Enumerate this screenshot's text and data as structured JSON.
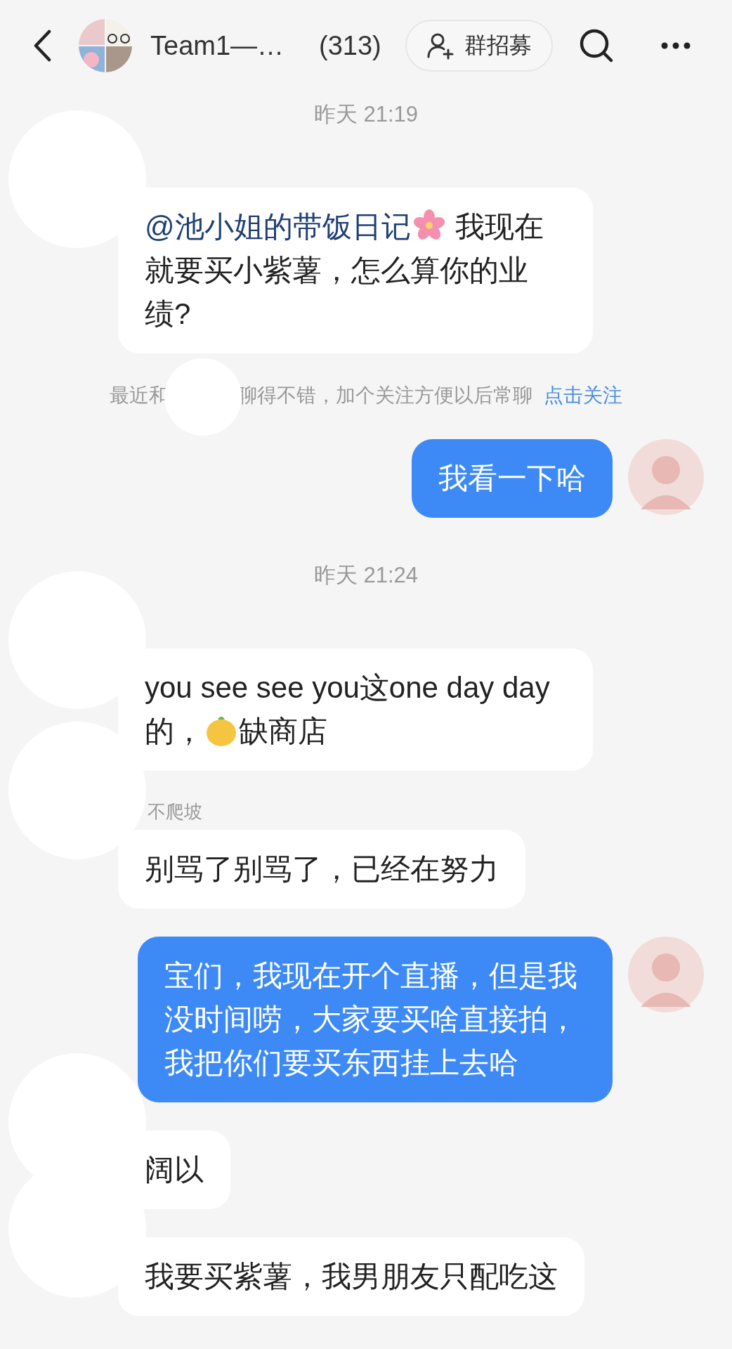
{
  "header": {
    "title": "Team1—…",
    "count": "(313)",
    "recruit_button": "群招募"
  },
  "messages": [
    {
      "kind": "time",
      "text": "昨天 21:19"
    },
    {
      "kind": "incoming",
      "avatar_masked": true,
      "parts": [
        {
          "kind": "mention",
          "text": "@池小姐的带饭日记"
        },
        {
          "kind": "flower"
        },
        {
          "kind": "text",
          "text": " 我现在就要买小紫薯，怎么算你的业绩?"
        }
      ]
    },
    {
      "kind": "notice",
      "before": "最近和",
      "masked": true,
      "after": "聊得不错，加个关注方便以后常聊",
      "link": "点击关注"
    },
    {
      "kind": "outgoing",
      "parts": [
        {
          "kind": "text",
          "text": "我看一下哈"
        }
      ]
    },
    {
      "kind": "time",
      "text": "昨天 21:24"
    },
    {
      "kind": "incoming",
      "avatar_masked": true,
      "parts": [
        {
          "kind": "text",
          "text": "you see see you这one day day 的，"
        },
        {
          "kind": "sticker"
        },
        {
          "kind": "text",
          "text": "缺商店"
        }
      ]
    },
    {
      "kind": "incoming",
      "avatar_masked": true,
      "sender": "不爬坡",
      "parts": [
        {
          "kind": "text",
          "text": "别骂了别骂了，已经在努力"
        }
      ]
    },
    {
      "kind": "outgoing",
      "parts": [
        {
          "kind": "text",
          "text": "宝们，我现在开个直播，但是我没时间唠，大家要买啥直接拍，我把你们要买东西挂上去哈"
        }
      ]
    },
    {
      "kind": "incoming",
      "avatar_masked": true,
      "parts": [
        {
          "kind": "text",
          "text": "阔以"
        }
      ]
    },
    {
      "kind": "incoming",
      "avatar_masked": true,
      "parts": [
        {
          "kind": "text",
          "text": "我要买紫薯，我男朋友只配吃这"
        }
      ]
    }
  ]
}
